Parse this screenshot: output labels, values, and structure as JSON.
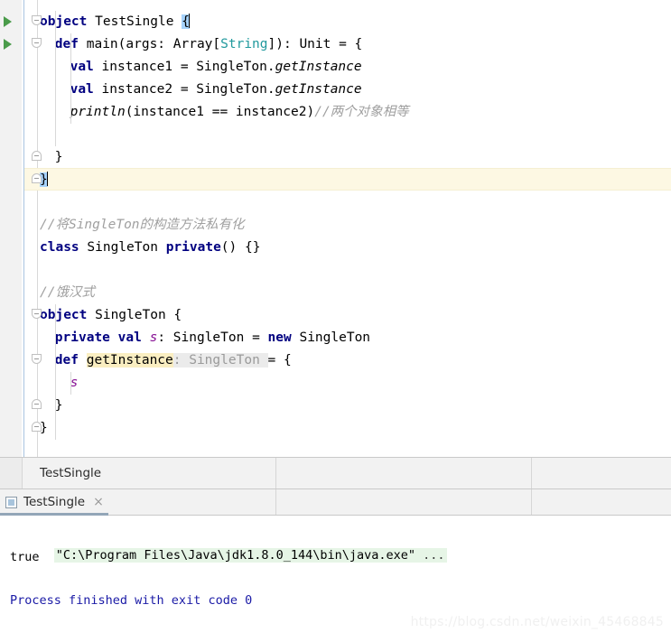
{
  "editor": {
    "lines": [
      {
        "n": 1,
        "indent": 0,
        "tokens": [
          {
            "t": "object",
            "c": "kw"
          },
          {
            "t": " ",
            "c": "plain"
          },
          {
            "t": "TestSingle",
            "c": "plain"
          },
          {
            "t": " ",
            "c": "plain"
          },
          {
            "t": "{",
            "c": "sel"
          }
        ],
        "run_marker": true,
        "fold": "open",
        "caret_after": true
      },
      {
        "n": 2,
        "indent": 1,
        "tokens": [
          {
            "t": "def",
            "c": "kw"
          },
          {
            "t": " main(args: Array[",
            "c": "plain"
          },
          {
            "t": "String",
            "c": "typ"
          },
          {
            "t": "]): Unit = {",
            "c": "plain"
          }
        ],
        "run_marker": true,
        "fold": "open"
      },
      {
        "n": 3,
        "indent": 2,
        "tokens": [
          {
            "t": "val",
            "c": "kw"
          },
          {
            "t": " instance1 = SingleTon.",
            "c": "plain"
          },
          {
            "t": "getInstance",
            "c": "meth"
          }
        ]
      },
      {
        "n": 4,
        "indent": 2,
        "tokens": [
          {
            "t": "val",
            "c": "kw"
          },
          {
            "t": " instance2 = SingleTon.",
            "c": "plain"
          },
          {
            "t": "getInstance",
            "c": "meth"
          }
        ]
      },
      {
        "n": 5,
        "indent": 2,
        "tokens": [
          {
            "t": "println",
            "c": "meth"
          },
          {
            "t": "(instance1 == instance2)",
            "c": "plain"
          },
          {
            "t": "//两个对象相等",
            "c": "cmt"
          }
        ]
      },
      {
        "n": 6,
        "indent": 0,
        "tokens": []
      },
      {
        "n": 7,
        "indent": 1,
        "tokens": [
          {
            "t": "}",
            "c": "plain"
          }
        ],
        "fold": "close"
      },
      {
        "n": 8,
        "indent": 0,
        "tokens": [
          {
            "t": "}",
            "c": "sel"
          }
        ],
        "fold": "close",
        "current": true,
        "caret_after": true
      },
      {
        "n": 9,
        "indent": 0,
        "tokens": []
      },
      {
        "n": 10,
        "indent": 0,
        "tokens": [
          {
            "t": "//将SingleTon的构造方法私有化",
            "c": "cmt"
          }
        ]
      },
      {
        "n": 11,
        "indent": 0,
        "tokens": [
          {
            "t": "class",
            "c": "kw"
          },
          {
            "t": " SingleTon ",
            "c": "plain"
          },
          {
            "t": "private",
            "c": "kw"
          },
          {
            "t": "() {}",
            "c": "plain"
          }
        ]
      },
      {
        "n": 12,
        "indent": 0,
        "tokens": []
      },
      {
        "n": 13,
        "indent": 0,
        "tokens": [
          {
            "t": "//饿汉式",
            "c": "cmt"
          }
        ]
      },
      {
        "n": 14,
        "indent": 0,
        "tokens": [
          {
            "t": "object",
            "c": "kw"
          },
          {
            "t": " SingleTon {",
            "c": "plain"
          }
        ],
        "fold": "open"
      },
      {
        "n": 15,
        "indent": 1,
        "tokens": [
          {
            "t": "private",
            "c": "kw"
          },
          {
            "t": " ",
            "c": "plain"
          },
          {
            "t": "val",
            "c": "kw"
          },
          {
            "t": " ",
            "c": "plain"
          },
          {
            "t": "s",
            "c": "var"
          },
          {
            "t": ": SingleTon = ",
            "c": "plain"
          },
          {
            "t": "new",
            "c": "kw"
          },
          {
            "t": " SingleTon",
            "c": "plain"
          }
        ]
      },
      {
        "n": 16,
        "indent": 1,
        "tokens": [
          {
            "t": "def",
            "c": "kw"
          },
          {
            "t": " ",
            "c": "plain"
          },
          {
            "t": "getInstance",
            "c": "hl-ident"
          },
          {
            "t": ": SingleTon ",
            "c": "hint"
          },
          {
            "t": "= {",
            "c": "plain"
          }
        ],
        "fold": "open"
      },
      {
        "n": 17,
        "indent": 2,
        "tokens": [
          {
            "t": "s",
            "c": "var"
          }
        ]
      },
      {
        "n": 18,
        "indent": 1,
        "tokens": [
          {
            "t": "}",
            "c": "plain"
          }
        ],
        "fold": "close"
      },
      {
        "n": 19,
        "indent": 0,
        "tokens": [
          {
            "t": "}",
            "c": "plain"
          }
        ],
        "fold": "close"
      }
    ]
  },
  "breadcrumb": {
    "crumb": "TestSingle"
  },
  "run_panel": {
    "tab": {
      "icon": "run-configuration-icon",
      "label": "TestSingle",
      "close": "×"
    },
    "console": {
      "command": "\"C:\\Program Files\\Java\\jdk1.8.0_144\\bin\\java.exe\"",
      "command_ellipsis": " ...",
      "output": "true",
      "exit_message": "Process finished with exit code 0"
    }
  },
  "watermark": {
    "text": "https://blog.csdn.net/weixin_45468845"
  }
}
